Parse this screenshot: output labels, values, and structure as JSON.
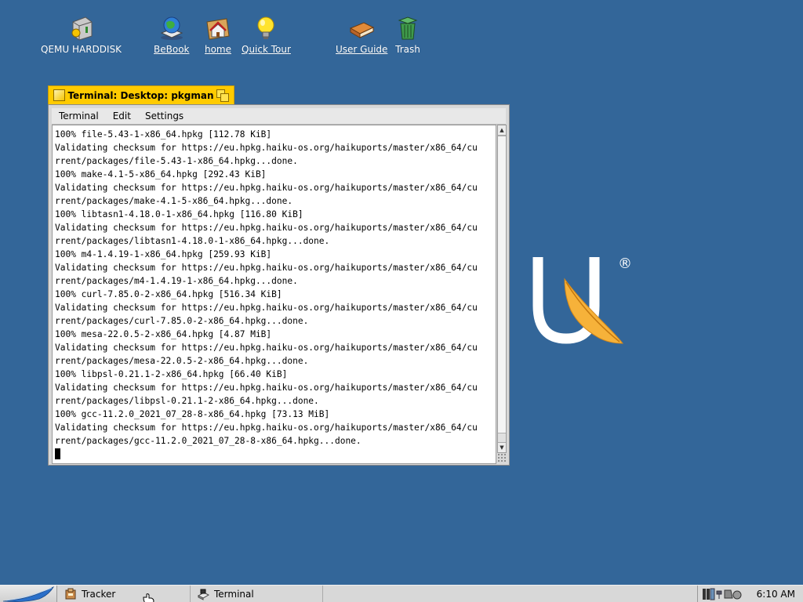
{
  "desktop": {
    "icons": [
      {
        "label": "QEMU HARDDISK",
        "icon": "harddisk-icon"
      },
      {
        "label": "BeBook",
        "icon": "bebook-icon"
      },
      {
        "label": "home",
        "icon": "home-folder-icon"
      },
      {
        "label": "Quick Tour",
        "icon": "lightbulb-icon"
      },
      {
        "label": "User Guide",
        "icon": "book-icon"
      },
      {
        "label": "Trash",
        "icon": "trash-icon"
      }
    ]
  },
  "window": {
    "title": "Terminal: Desktop: pkgman",
    "menus": [
      "Terminal",
      "Edit",
      "Settings"
    ],
    "output_lines": [
      "100% file-5.43-1-x86_64.hpkg [112.78 KiB]",
      "Validating checksum for https://eu.hpkg.haiku-os.org/haikuports/master/x86_64/cu",
      "rrent/packages/file-5.43-1-x86_64.hpkg...done.",
      "100% make-4.1-5-x86_64.hpkg [292.43 KiB]",
      "Validating checksum for https://eu.hpkg.haiku-os.org/haikuports/master/x86_64/cu",
      "rrent/packages/make-4.1-5-x86_64.hpkg...done.",
      "100% libtasn1-4.18.0-1-x86_64.hpkg [116.80 KiB]",
      "Validating checksum for https://eu.hpkg.haiku-os.org/haikuports/master/x86_64/cu",
      "rrent/packages/libtasn1-4.18.0-1-x86_64.hpkg...done.",
      "100% m4-1.4.19-1-x86_64.hpkg [259.93 KiB]",
      "Validating checksum for https://eu.hpkg.haiku-os.org/haikuports/master/x86_64/cu",
      "rrent/packages/m4-1.4.19-1-x86_64.hpkg...done.",
      "100% curl-7.85.0-2-x86_64.hpkg [516.34 KiB]",
      "Validating checksum for https://eu.hpkg.haiku-os.org/haikuports/master/x86_64/cu",
      "rrent/packages/curl-7.85.0-2-x86_64.hpkg...done.",
      "100% mesa-22.0.5-2-x86_64.hpkg [4.87 MiB]",
      "Validating checksum for https://eu.hpkg.haiku-os.org/haikuports/master/x86_64/cu",
      "rrent/packages/mesa-22.0.5-2-x86_64.hpkg...done.",
      "100% libpsl-0.21.1-2-x86_64.hpkg [66.40 KiB]",
      "Validating checksum for https://eu.hpkg.haiku-os.org/haikuports/master/x86_64/cu",
      "rrent/packages/libpsl-0.21.1-2-x86_64.hpkg...done.",
      "100% gcc-11.2.0_2021_07_28-8-x86_64.hpkg [73.13 MiB]",
      "Validating checksum for https://eu.hpkg.haiku-os.org/haikuports/master/x86_64/cu",
      "rrent/packages/gcc-11.2.0_2021_07_28-8-x86_64.hpkg...done."
    ]
  },
  "taskbar": {
    "items": [
      {
        "label": "Tracker",
        "icon": "tracker-icon"
      },
      {
        "label": "Terminal",
        "icon": "terminal-icon"
      }
    ],
    "clock": "6:10 AM"
  },
  "logo": {
    "mark": "®"
  },
  "colors": {
    "desktop": "#336699",
    "tab": "#ffcb00",
    "window": "#d8d8d8",
    "terminal_bg": "#ffffff",
    "terminal_fg": "#000000"
  }
}
